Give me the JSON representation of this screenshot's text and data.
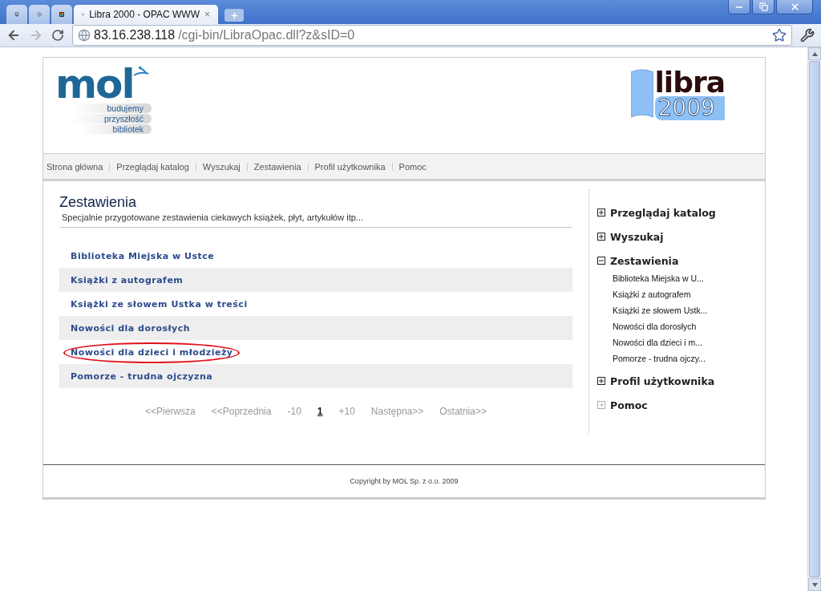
{
  "browser": {
    "tabs": [
      {
        "kind": "icon",
        "selected": false
      },
      {
        "kind": "icon",
        "selected": false
      },
      {
        "kind": "icon",
        "selected": false
      },
      {
        "kind": "text",
        "title": "Libra 2000 - OPAC WWW",
        "close": "×",
        "selected": true
      }
    ],
    "url_host": "83.16.238.118",
    "url_path": "/cgi-bin/LibraOpac.dll?z&sID=0"
  },
  "header": {
    "logo_left": {
      "name": "mol",
      "taglines": [
        "budujemy",
        "przyszłość",
        "bibliotek"
      ]
    },
    "logo_right": {
      "name": "libra",
      "year": "2009"
    }
  },
  "nav": [
    "Strona główna",
    "Przeglądaj katalog",
    "Wyszukaj",
    "Zestawienia",
    "Profil użytkownika",
    "Pomoc"
  ],
  "content": {
    "title": "Zestawienia",
    "subtitle": "Specjalnie przygotowane zestawienia ciekawych książek, płyt, artykułów itp...",
    "lists": [
      {
        "label": "Biblioteka Miejska w Ustce",
        "circled": false
      },
      {
        "label": "Książki z autografem",
        "circled": false
      },
      {
        "label": "Książki ze słowem Ustka w treści",
        "circled": false
      },
      {
        "label": "Nowości dla dorosłych",
        "circled": false
      },
      {
        "label": "Nowości dla dzieci i młodzieży",
        "circled": true
      },
      {
        "label": "Pomorze - trudna ojczyzna",
        "circled": false
      }
    ],
    "pagination": [
      {
        "label": "<<Pierwsza",
        "selected": false
      },
      {
        "label": "<<Poprzednia",
        "selected": false
      },
      {
        "label": "-10",
        "selected": false
      },
      {
        "label": "1",
        "selected": true
      },
      {
        "label": "+10",
        "selected": false
      },
      {
        "label": "Następna>>",
        "selected": false
      },
      {
        "label": "Ostatnia>>",
        "selected": false
      }
    ]
  },
  "sidebar": [
    {
      "label": "Przeglądaj katalog",
      "expanded": false,
      "disabled": false
    },
    {
      "label": "Wyszukaj",
      "expanded": false,
      "disabled": false
    },
    {
      "label": "Zestawienia",
      "expanded": true,
      "disabled": false,
      "children": [
        {
          "label": "Biblioteka Miejska w U..."
        },
        {
          "label": "Książki z autografem"
        },
        {
          "label": "Książki ze słowem Ustk..."
        },
        {
          "label": "Nowości dla dorosłych"
        },
        {
          "label": "Nowości dla dzieci i m..."
        },
        {
          "label": "Pomorze - trudna ojczy..."
        }
      ]
    },
    {
      "label": "Profil użytkownika",
      "expanded": false,
      "disabled": false
    },
    {
      "label": "Pomoc",
      "expanded": false,
      "disabled": true
    }
  ],
  "footer": "Copyright by MOL Sp. z o.o. 2009"
}
